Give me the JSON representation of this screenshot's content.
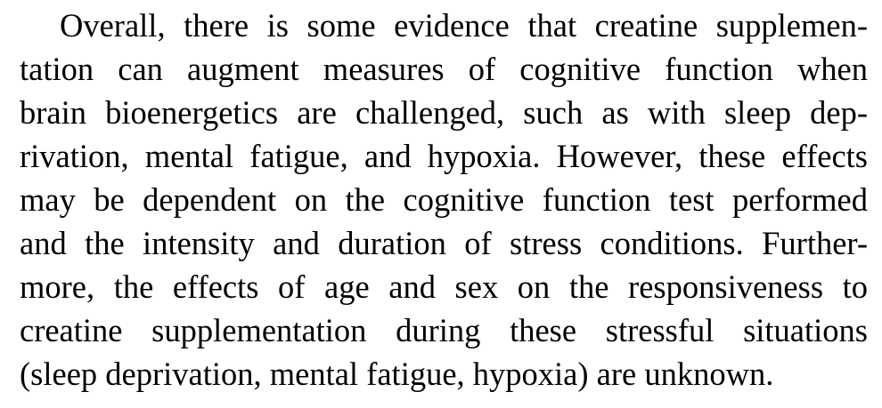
{
  "paragraph": {
    "lines": [
      "Overall, there is some evidence that creatine supplemen-",
      "tation can augment measures of cognitive function when",
      "brain bioenergetics are challenged, such as with sleep dep-",
      "rivation, mental fatigue, and hypoxia. However, these effects",
      "may be dependent on the cognitive function test performed",
      "and the intensity and duration of stress conditions. Further-",
      "more, the effects of age and sex on the responsiveness to",
      "creatine supplementation during these stressful situations",
      "(sleep deprivation, mental fatigue, hypoxia) are unknown."
    ]
  }
}
